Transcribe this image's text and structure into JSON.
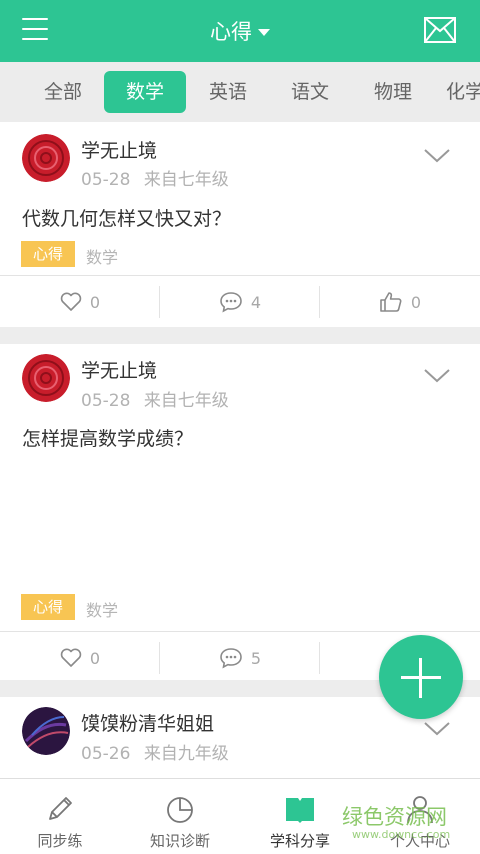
{
  "header": {
    "title": "心得",
    "menu_icon": "hamburger-menu-icon",
    "mail_icon": "mail-icon"
  },
  "tabs": [
    "全部",
    "数学",
    "英语",
    "语文",
    "物理",
    "化学"
  ],
  "active_tab": "数学",
  "posts": [
    {
      "user": "学无止境",
      "date": "05-28",
      "source": "来自七年级",
      "title": "代数几何怎样又快又对？",
      "tag": "心得",
      "subject": "数学",
      "likes": "0",
      "comments": "4",
      "thumbs": "0"
    },
    {
      "user": "学无止境",
      "date": "05-28",
      "source": "来自七年级",
      "title": "怎样提高数学成绩？",
      "tag": "心得",
      "subject": "数学",
      "likes": "0",
      "comments": "5",
      "thumbs": ""
    },
    {
      "user": "馍馍粉清华姐姐",
      "date": "05-26",
      "source": "来自九年级"
    }
  ],
  "bottom_nav": [
    {
      "label": "同步练",
      "icon": "pencil-icon"
    },
    {
      "label": "知识诊断",
      "icon": "pie-chart-icon"
    },
    {
      "label": "学科分享",
      "icon": "open-book-icon"
    },
    {
      "label": "个人中心",
      "icon": "person-icon"
    }
  ],
  "active_nav": "学科分享",
  "watermark": {
    "text": "绿色资源网",
    "url": "www.downcc.com"
  },
  "colors": {
    "accent": "#2dc593",
    "tag": "#f8c553",
    "text_primary": "#333333",
    "text_secondary": "#b2b2b2"
  }
}
